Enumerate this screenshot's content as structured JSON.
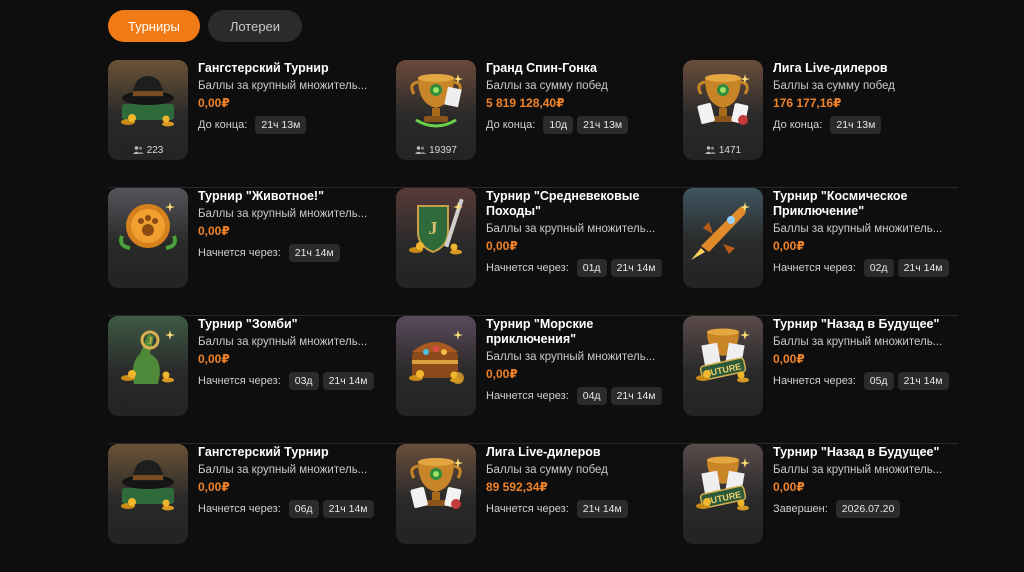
{
  "tabs": {
    "active": "Турниры",
    "inactive": "Лотереи"
  },
  "rows": [
    [
      {
        "title": "Гангстерский Турнир",
        "desc": "Баллы за крупный множитель...",
        "amount": "0,00₽",
        "timer_label": "До конца:",
        "chips": [
          "21ч 13м"
        ],
        "players": "223",
        "art": "hat",
        "bg": "#6b5236"
      },
      {
        "title": "Гранд Спин-Гонка",
        "desc": "Баллы за сумму побед",
        "amount": "5 819 128,40₽",
        "timer_label": "До конца:",
        "chips": [
          "10д",
          "21ч 13м"
        ],
        "players": "19397",
        "art": "trophy",
        "bg": "#6b4a3a"
      },
      {
        "title": "Лига Live-дилеров",
        "desc": "Баллы за сумму побед",
        "amount": "176 177,16₽",
        "timer_label": "До конца:",
        "chips": [
          "21ч 13м"
        ],
        "players": "1471",
        "art": "trophy-cards",
        "bg": "#6b4e3c"
      }
    ],
    [
      {
        "title": "Турнир \"Животное!\"",
        "desc": "Баллы за крупный множитель...",
        "amount": "0,00₽",
        "timer_label": "Начнется через:",
        "chips": [
          "21ч 14м"
        ],
        "players": "",
        "art": "coin",
        "bg": "#55545b"
      },
      {
        "title": "Турнир \"Средневековые Походы\"",
        "desc": "Баллы за крупный множитель...",
        "amount": "0,00₽",
        "timer_label": "Начнется через:",
        "chips": [
          "01д",
          "21ч 14м"
        ],
        "players": "",
        "art": "shield",
        "bg": "#5a3a3a"
      },
      {
        "title": "Турнир \"Космическое Приключение\"",
        "desc": "Баллы за крупный множитель...",
        "amount": "0,00₽",
        "timer_label": "Начнется через:",
        "chips": [
          "02д",
          "21ч 14м"
        ],
        "players": "",
        "art": "rocket",
        "bg": "#3e5560"
      }
    ],
    [
      {
        "title": "Турнир \"Зомби\"",
        "desc": "Баллы за крупный множитель...",
        "amount": "0,00₽",
        "timer_label": "Начнется через:",
        "chips": [
          "03д",
          "21ч 14м"
        ],
        "players": "",
        "art": "zombie",
        "bg": "#3e5a45"
      },
      {
        "title": "Турнир \"Морские приключения\"",
        "desc": "Баллы за крупный множитель...",
        "amount": "0,00₽",
        "timer_label": "Начнется через:",
        "chips": [
          "04д",
          "21ч 14м"
        ],
        "players": "",
        "art": "chest",
        "bg": "#5a4a5a"
      },
      {
        "title": "Турнир \"Назад в Будущее\"",
        "desc": "Баллы за крупный множитель...",
        "amount": "0,00₽",
        "timer_label": "Начнется через:",
        "chips": [
          "05д",
          "21ч 14м"
        ],
        "players": "",
        "art": "future",
        "bg": "#5a4a4a"
      }
    ],
    [
      {
        "title": "Гангстерский Турнир",
        "desc": "Баллы за крупный множитель...",
        "amount": "0,00₽",
        "timer_label": "Начнется через:",
        "chips": [
          "06д",
          "21ч 14м"
        ],
        "players": "",
        "art": "hat",
        "bg": "#6b5236"
      },
      {
        "title": "Лига Live-дилеров",
        "desc": "Баллы за сумму побед",
        "amount": "89 592,34₽",
        "timer_label": "Начнется через:",
        "chips": [
          "21ч 14м"
        ],
        "players": "",
        "art": "trophy-cards",
        "bg": "#6b4e3c"
      },
      {
        "title": "Турнир \"Назад в Будущее\"",
        "desc": "Баллы за крупный множитель...",
        "amount": "0,00₽",
        "timer_label": "Завершен:",
        "chips": [
          "2026.07.20"
        ],
        "players": "",
        "art": "future",
        "bg": "#5a4a4a"
      }
    ]
  ],
  "colors": {
    "accent": "#f07a16",
    "amount": "#f0832a",
    "chip": "#2b2b2b",
    "bg": "#0e0e0e"
  }
}
